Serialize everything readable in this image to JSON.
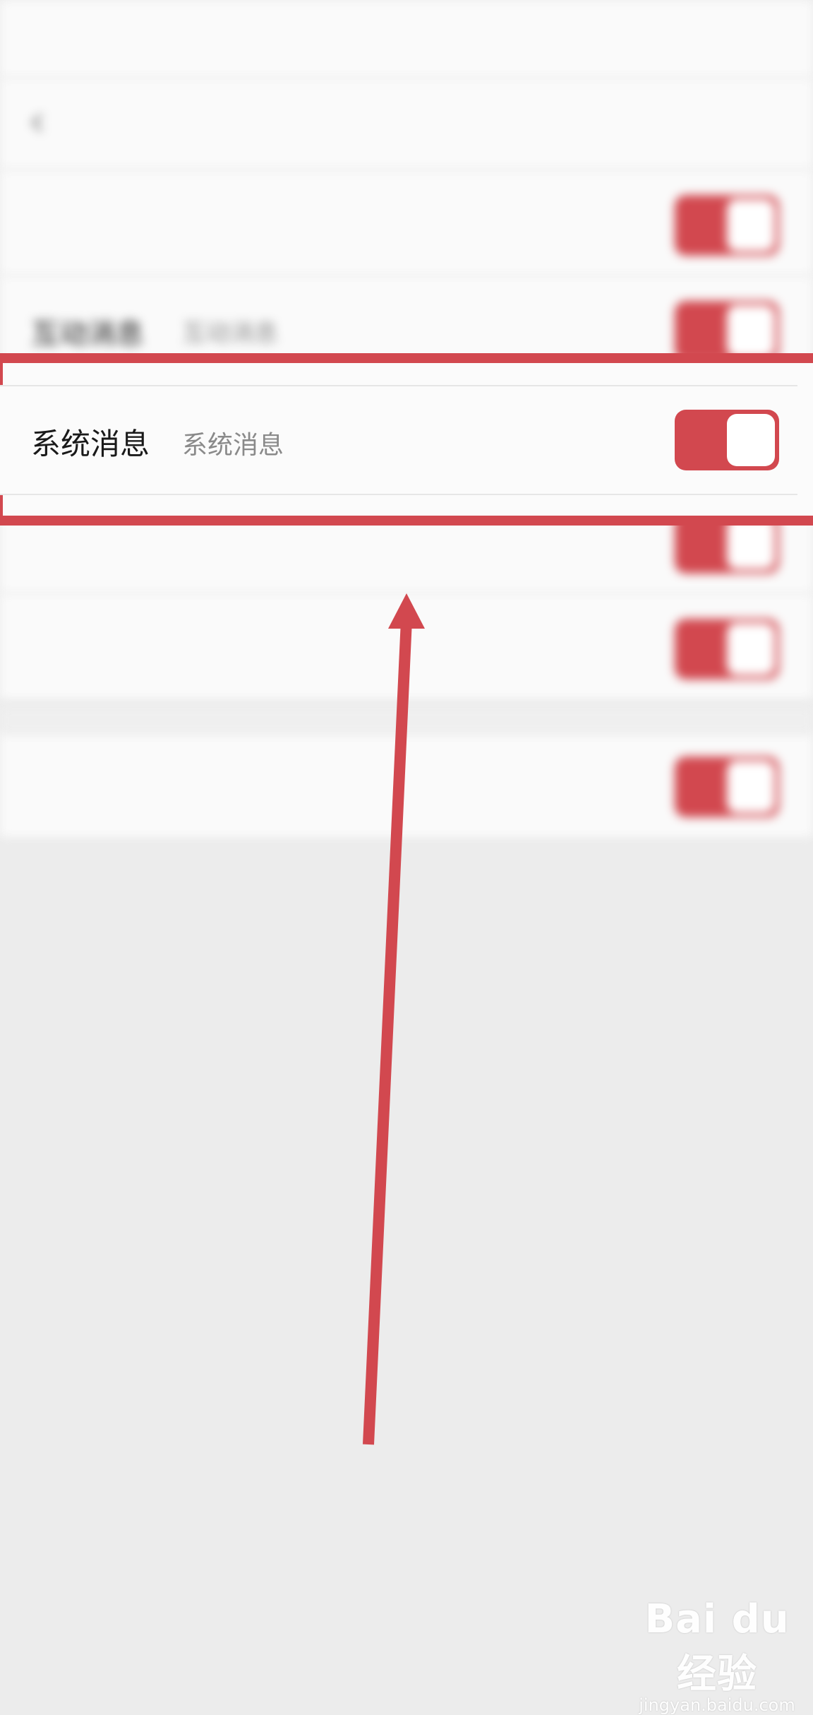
{
  "status_bar": {
    "time": "",
    "icons": ""
  },
  "nav": {
    "title": ""
  },
  "settings": [
    {
      "name": "互动消息",
      "desc": "互动消息",
      "enabled": true
    },
    {
      "name": "系统消息",
      "desc": "系统消息",
      "enabled": true
    }
  ],
  "highlight_color": "#d2484f",
  "toggle_on_color": "#d2484f",
  "watermark": {
    "logo": "Bai du 经验",
    "url": "jingyan.baidu.com"
  }
}
